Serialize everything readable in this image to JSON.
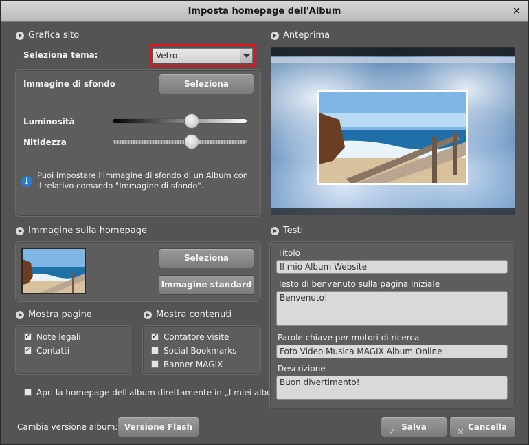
{
  "window": {
    "title": "Imposta homepage dell'Album",
    "close_symbol": "✕"
  },
  "grafica": {
    "title": "Grafica sito",
    "theme_label": "Seleziona tema:",
    "theme_value": "Vetro",
    "bg_image_label": "Immagine di sfondo",
    "bg_select_button": "Seleziona",
    "brightness_label": "Luminosità",
    "brightness_value": 0.6,
    "sharpness_label": "Nitidezza",
    "sharpness_value": 0.6,
    "info_text": "Puoi impostare l'immagine di sfondo di un Album con il relativo comando \"Immagine di sfondo\"."
  },
  "preview": {
    "title": "Anteprima"
  },
  "homepage_image": {
    "title": "Immagine sulla homepage",
    "select_button": "Seleziona",
    "standard_button": "Immagine standard"
  },
  "mostra_pagine": {
    "title": "Mostra pagine",
    "items": [
      {
        "label": "Note legali",
        "checked": true
      },
      {
        "label": "Contatti",
        "checked": true
      }
    ]
  },
  "mostra_contenuti": {
    "title": "Mostra contenuti",
    "items": [
      {
        "label": "Contatore visite",
        "checked": true
      },
      {
        "label": "Social Bookmarks",
        "checked": false
      },
      {
        "label": "Banner MAGIX",
        "checked": false
      }
    ]
  },
  "open_direct": {
    "label": "Apri la homepage dell'album direttamente in „I miei album\"",
    "checked": false
  },
  "testi": {
    "title": "Testi",
    "titolo_label": "Titolo",
    "titolo_value": "Il mio Album Website",
    "welcome_label": "Testo di benvenuto sulla pagina iniziale",
    "welcome_value": "Benvenuto!",
    "keywords_label": "Parole chiave per motori di ricerca",
    "keywords_value": "Foto Video Musica MAGIX Album Online",
    "desc_label": "Descrizione",
    "desc_value": "Buon divertimento!"
  },
  "footer": {
    "version_label": "Cambia versione album:",
    "flash_button": "Versione Flash",
    "save_button": "Salva",
    "cancel_button": "Cancella"
  }
}
